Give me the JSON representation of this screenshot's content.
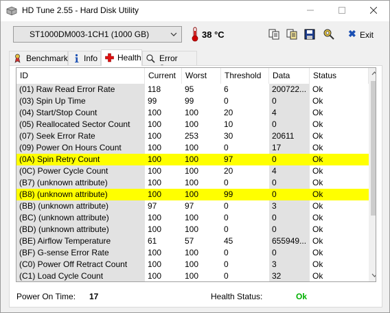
{
  "window": {
    "title": "HD Tune 2.55 - Hard Disk Utility"
  },
  "toolbar": {
    "drive": "ST1000DM003-1CH1 (1000 GB)",
    "temperature": "38 °C",
    "exit_label": "Exit",
    "exit_x": "✖"
  },
  "tabs": [
    {
      "label": "Benchmark",
      "icon": "benchmark-icon"
    },
    {
      "label": "Info",
      "icon": "info-icon"
    },
    {
      "label": "Health",
      "icon": "health-cross-icon",
      "active": true
    },
    {
      "label": "Error Scan",
      "icon": "error-scan-icon"
    }
  ],
  "table": {
    "headers": [
      "ID",
      "Current",
      "Worst",
      "Threshold",
      "Data",
      "Status"
    ],
    "rows": [
      {
        "id": "(01) Raw Read Error Rate",
        "current": "118",
        "worst": "95",
        "threshold": "6",
        "data": "200722...",
        "status": "Ok"
      },
      {
        "id": "(03) Spin Up Time",
        "current": "99",
        "worst": "99",
        "threshold": "0",
        "data": "0",
        "status": "Ok"
      },
      {
        "id": "(04) Start/Stop Count",
        "current": "100",
        "worst": "100",
        "threshold": "20",
        "data": "4",
        "status": "Ok"
      },
      {
        "id": "(05) Reallocated Sector Count",
        "current": "100",
        "worst": "100",
        "threshold": "10",
        "data": "0",
        "status": "Ok"
      },
      {
        "id": "(07) Seek Error Rate",
        "current": "100",
        "worst": "253",
        "threshold": "30",
        "data": "20611",
        "status": "Ok"
      },
      {
        "id": "(09) Power On Hours Count",
        "current": "100",
        "worst": "100",
        "threshold": "0",
        "data": "17",
        "status": "Ok"
      },
      {
        "id": "(0A) Spin Retry Count",
        "current": "100",
        "worst": "100",
        "threshold": "97",
        "data": "0",
        "status": "Ok",
        "highlight": true
      },
      {
        "id": "(0C) Power Cycle Count",
        "current": "100",
        "worst": "100",
        "threshold": "20",
        "data": "4",
        "status": "Ok"
      },
      {
        "id": "(B7) (unknown attribute)",
        "current": "100",
        "worst": "100",
        "threshold": "0",
        "data": "0",
        "status": "Ok"
      },
      {
        "id": "(B8) (unknown attribute)",
        "current": "100",
        "worst": "100",
        "threshold": "99",
        "data": "0",
        "status": "Ok",
        "highlight": true
      },
      {
        "id": "(BB) (unknown attribute)",
        "current": "97",
        "worst": "97",
        "threshold": "0",
        "data": "3",
        "status": "Ok"
      },
      {
        "id": "(BC) (unknown attribute)",
        "current": "100",
        "worst": "100",
        "threshold": "0",
        "data": "0",
        "status": "Ok"
      },
      {
        "id": "(BD) (unknown attribute)",
        "current": "100",
        "worst": "100",
        "threshold": "0",
        "data": "0",
        "status": "Ok"
      },
      {
        "id": "(BE) Airflow Temperature",
        "current": "61",
        "worst": "57",
        "threshold": "45",
        "data": "655949...",
        "status": "Ok"
      },
      {
        "id": "(BF) G-sense Error Rate",
        "current": "100",
        "worst": "100",
        "threshold": "0",
        "data": "0",
        "status": "Ok"
      },
      {
        "id": "(C0) Power Off Retract Count",
        "current": "100",
        "worst": "100",
        "threshold": "0",
        "data": "3",
        "status": "Ok"
      },
      {
        "id": "(C1) Load Cycle Count",
        "current": "100",
        "worst": "100",
        "threshold": "0",
        "data": "32",
        "status": "Ok"
      }
    ]
  },
  "footer": {
    "power_on_label": "Power On Time:",
    "power_on_value": "17",
    "health_label": "Health Status:",
    "health_value": "Ok"
  },
  "colors": {
    "highlight": "#ffff00",
    "ok_green": "#00b000",
    "id_column_bg": "#e2e2e2",
    "accent": "#1a4fb3"
  }
}
